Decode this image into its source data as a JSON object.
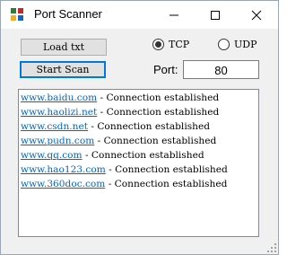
{
  "window": {
    "title": "Port Scanner",
    "icon": "app-grid-icon"
  },
  "toolbar": {
    "load_label": "Load txt",
    "scan_label": "Start Scan"
  },
  "protocol": {
    "options": [
      {
        "label": "TCP",
        "selected": true
      },
      {
        "label": "UDP",
        "selected": false
      }
    ]
  },
  "port": {
    "label": "Port:",
    "value": "80"
  },
  "log": {
    "lines": [
      {
        "domain": "www.baidu.com",
        "message": " - Connection established"
      },
      {
        "domain": "www.haolizi.net",
        "message": " - Connection established"
      },
      {
        "domain": "www.csdn.net",
        "message": " - Connection established"
      },
      {
        "domain": "www.pudn.com",
        "message": " - Connection established"
      },
      {
        "domain": "www.qq.com",
        "message": " - Connection established"
      },
      {
        "domain": "www.hao123.com",
        "message": " - Connection established"
      },
      {
        "domain": "www.360doc.com",
        "message": " - Connection established"
      }
    ]
  },
  "colors": {
    "link": "#0066cc",
    "focus": "#0078d7"
  }
}
